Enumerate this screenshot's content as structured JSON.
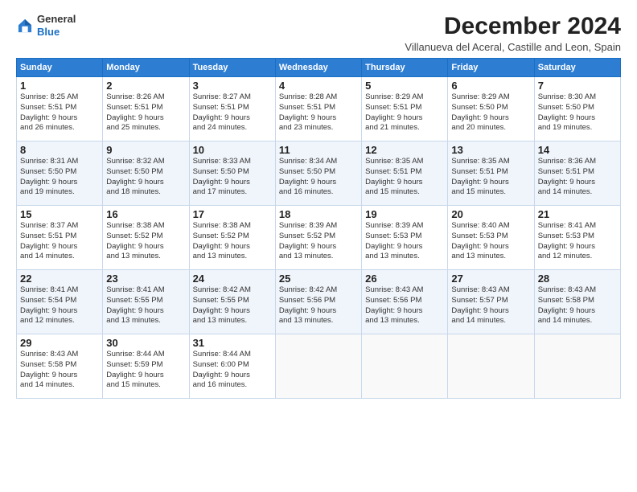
{
  "logo": {
    "general": "General",
    "blue": "Blue"
  },
  "header": {
    "month": "December 2024",
    "location": "Villanueva del Aceral, Castille and Leon, Spain"
  },
  "weekdays": [
    "Sunday",
    "Monday",
    "Tuesday",
    "Wednesday",
    "Thursday",
    "Friday",
    "Saturday"
  ],
  "weeks": [
    [
      {
        "day": "1",
        "info": "Sunrise: 8:25 AM\nSunset: 5:51 PM\nDaylight: 9 hours\nand 26 minutes."
      },
      {
        "day": "2",
        "info": "Sunrise: 8:26 AM\nSunset: 5:51 PM\nDaylight: 9 hours\nand 25 minutes."
      },
      {
        "day": "3",
        "info": "Sunrise: 8:27 AM\nSunset: 5:51 PM\nDaylight: 9 hours\nand 24 minutes."
      },
      {
        "day": "4",
        "info": "Sunrise: 8:28 AM\nSunset: 5:51 PM\nDaylight: 9 hours\nand 23 minutes."
      },
      {
        "day": "5",
        "info": "Sunrise: 8:29 AM\nSunset: 5:51 PM\nDaylight: 9 hours\nand 21 minutes."
      },
      {
        "day": "6",
        "info": "Sunrise: 8:29 AM\nSunset: 5:50 PM\nDaylight: 9 hours\nand 20 minutes."
      },
      {
        "day": "7",
        "info": "Sunrise: 8:30 AM\nSunset: 5:50 PM\nDaylight: 9 hours\nand 19 minutes."
      }
    ],
    [
      {
        "day": "8",
        "info": "Sunrise: 8:31 AM\nSunset: 5:50 PM\nDaylight: 9 hours\nand 19 minutes."
      },
      {
        "day": "9",
        "info": "Sunrise: 8:32 AM\nSunset: 5:50 PM\nDaylight: 9 hours\nand 18 minutes."
      },
      {
        "day": "10",
        "info": "Sunrise: 8:33 AM\nSunset: 5:50 PM\nDaylight: 9 hours\nand 17 minutes."
      },
      {
        "day": "11",
        "info": "Sunrise: 8:34 AM\nSunset: 5:50 PM\nDaylight: 9 hours\nand 16 minutes."
      },
      {
        "day": "12",
        "info": "Sunrise: 8:35 AM\nSunset: 5:51 PM\nDaylight: 9 hours\nand 15 minutes."
      },
      {
        "day": "13",
        "info": "Sunrise: 8:35 AM\nSunset: 5:51 PM\nDaylight: 9 hours\nand 15 minutes."
      },
      {
        "day": "14",
        "info": "Sunrise: 8:36 AM\nSunset: 5:51 PM\nDaylight: 9 hours\nand 14 minutes."
      }
    ],
    [
      {
        "day": "15",
        "info": "Sunrise: 8:37 AM\nSunset: 5:51 PM\nDaylight: 9 hours\nand 14 minutes."
      },
      {
        "day": "16",
        "info": "Sunrise: 8:38 AM\nSunset: 5:52 PM\nDaylight: 9 hours\nand 13 minutes."
      },
      {
        "day": "17",
        "info": "Sunrise: 8:38 AM\nSunset: 5:52 PM\nDaylight: 9 hours\nand 13 minutes."
      },
      {
        "day": "18",
        "info": "Sunrise: 8:39 AM\nSunset: 5:52 PM\nDaylight: 9 hours\nand 13 minutes."
      },
      {
        "day": "19",
        "info": "Sunrise: 8:39 AM\nSunset: 5:53 PM\nDaylight: 9 hours\nand 13 minutes."
      },
      {
        "day": "20",
        "info": "Sunrise: 8:40 AM\nSunset: 5:53 PM\nDaylight: 9 hours\nand 13 minutes."
      },
      {
        "day": "21",
        "info": "Sunrise: 8:41 AM\nSunset: 5:53 PM\nDaylight: 9 hours\nand 12 minutes."
      }
    ],
    [
      {
        "day": "22",
        "info": "Sunrise: 8:41 AM\nSunset: 5:54 PM\nDaylight: 9 hours\nand 12 minutes."
      },
      {
        "day": "23",
        "info": "Sunrise: 8:41 AM\nSunset: 5:55 PM\nDaylight: 9 hours\nand 13 minutes."
      },
      {
        "day": "24",
        "info": "Sunrise: 8:42 AM\nSunset: 5:55 PM\nDaylight: 9 hours\nand 13 minutes."
      },
      {
        "day": "25",
        "info": "Sunrise: 8:42 AM\nSunset: 5:56 PM\nDaylight: 9 hours\nand 13 minutes."
      },
      {
        "day": "26",
        "info": "Sunrise: 8:43 AM\nSunset: 5:56 PM\nDaylight: 9 hours\nand 13 minutes."
      },
      {
        "day": "27",
        "info": "Sunrise: 8:43 AM\nSunset: 5:57 PM\nDaylight: 9 hours\nand 14 minutes."
      },
      {
        "day": "28",
        "info": "Sunrise: 8:43 AM\nSunset: 5:58 PM\nDaylight: 9 hours\nand 14 minutes."
      }
    ],
    [
      {
        "day": "29",
        "info": "Sunrise: 8:43 AM\nSunset: 5:58 PM\nDaylight: 9 hours\nand 14 minutes."
      },
      {
        "day": "30",
        "info": "Sunrise: 8:44 AM\nSunset: 5:59 PM\nDaylight: 9 hours\nand 15 minutes."
      },
      {
        "day": "31",
        "info": "Sunrise: 8:44 AM\nSunset: 6:00 PM\nDaylight: 9 hours\nand 16 minutes."
      },
      null,
      null,
      null,
      null
    ]
  ]
}
